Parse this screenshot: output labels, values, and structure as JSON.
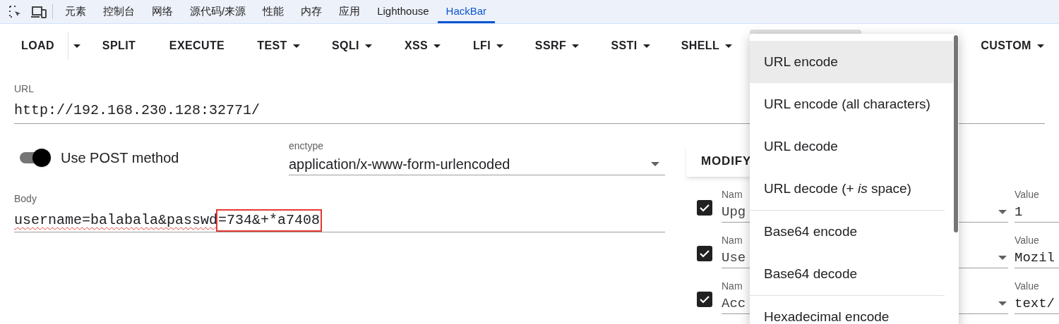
{
  "devtools_tabs": [
    {
      "label": "元素",
      "selected": false
    },
    {
      "label": "控制台",
      "selected": false
    },
    {
      "label": "网络",
      "selected": false
    },
    {
      "label": "源代码/来源",
      "selected": false
    },
    {
      "label": "性能",
      "selected": false
    },
    {
      "label": "内存",
      "selected": false
    },
    {
      "label": "应用",
      "selected": false
    },
    {
      "label": "Lighthouse",
      "selected": false
    },
    {
      "label": "HackBar",
      "selected": true
    }
  ],
  "toolbar": [
    {
      "kind": "split",
      "label": "LOAD"
    },
    {
      "kind": "plain",
      "label": "SPLIT"
    },
    {
      "kind": "plain",
      "label": "EXECUTE"
    },
    {
      "kind": "dropdown",
      "label": "TEST"
    },
    {
      "kind": "dropdown",
      "label": "SQLI"
    },
    {
      "kind": "dropdown",
      "label": "XSS"
    },
    {
      "kind": "dropdown",
      "label": "LFI"
    },
    {
      "kind": "dropdown",
      "label": "SSRF"
    },
    {
      "kind": "dropdown",
      "label": "SSTI"
    },
    {
      "kind": "dropdown",
      "label": "SHELL"
    },
    {
      "kind": "covered"
    },
    {
      "kind": "dropdown",
      "label": "CUSTOM"
    }
  ],
  "url": {
    "label": "URL",
    "value": "http://192.168.230.128:32771/"
  },
  "post_toggle": {
    "label": "Use POST method",
    "on": true
  },
  "enctype": {
    "label": "enctype",
    "value": "application/x-www-form-urlencoded"
  },
  "body": {
    "label": "Body",
    "value": "username=balabala&passwd",
    "highlight": "=734&+*a7408"
  },
  "modify_button": {
    "label": "MODIFY"
  },
  "headers": [
    {
      "checked": true,
      "name_label": "Nam",
      "name": "Upg",
      "value_label": "Value",
      "value": "1"
    },
    {
      "checked": true,
      "name_label": "Nam",
      "name": "Use",
      "value_label": "Value",
      "value": "Mozil"
    },
    {
      "checked": true,
      "name_label": "Nam",
      "name": "Acc",
      "value_label": "Value",
      "value": "text/"
    }
  ],
  "menu": [
    {
      "label": "URL encode",
      "selected": true,
      "divider_before": false
    },
    {
      "label": "URL encode (all characters)",
      "selected": false,
      "divider_before": false
    },
    {
      "label": "URL decode",
      "selected": false,
      "divider_before": false
    },
    {
      "label": "URL decode (+ *is* space)",
      "selected": false,
      "divider_before": false
    },
    {
      "label": "Base64 encode",
      "selected": false,
      "divider_before": true
    },
    {
      "label": "Base64 decode",
      "selected": false,
      "divider_before": false
    },
    {
      "label": "Hexadecimal encode",
      "selected": false,
      "divider_before": true
    }
  ]
}
